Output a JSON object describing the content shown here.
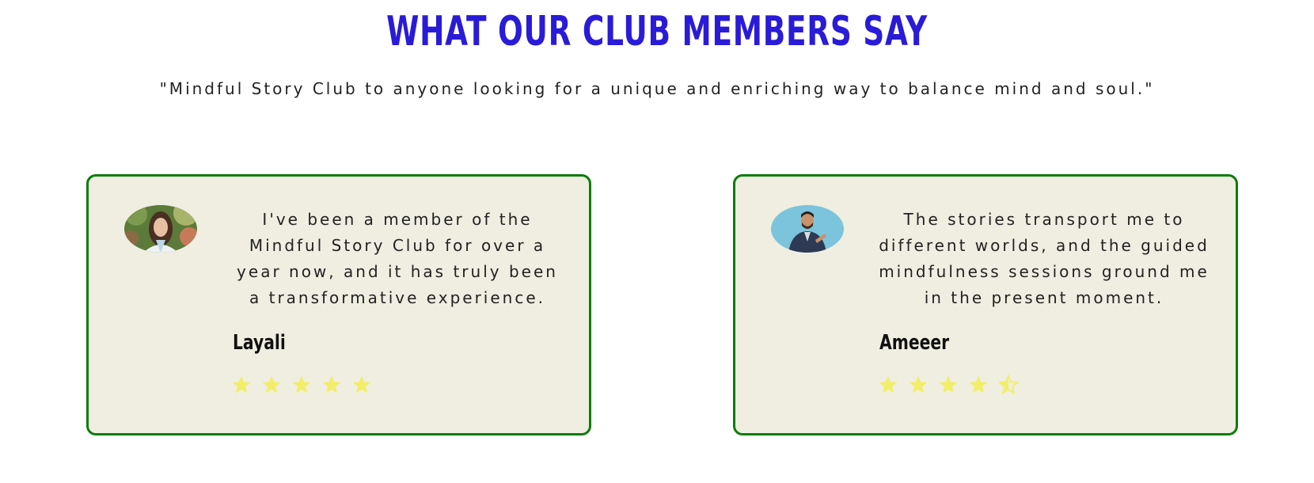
{
  "heading": "WHAT OUR CLUB MEMBERS SAY",
  "subtitle": "\"Mindful Story Club to anyone looking for a unique and enriching way to balance mind and soul.\"",
  "colors": {
    "heading": "#2a1bd8",
    "card_border": "#0a7d0a",
    "card_background": "#efeee1",
    "star": "#f2ee6a"
  },
  "testimonials": [
    {
      "quote": "I've been a member of the Mindful Story Club for over a year now, and it has truly been a transformative experience.",
      "name": "Layali",
      "avatar_icon": "woman-portrait-photo",
      "rating": 5
    },
    {
      "quote": "The stories transport me to different worlds, and the guided mindfulness sessions ground me in the present moment.",
      "name": "Ameeer",
      "avatar_icon": "man-portrait-photo",
      "rating": 4.5
    }
  ]
}
